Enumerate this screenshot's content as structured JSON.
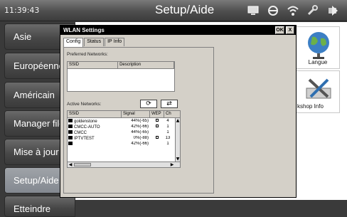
{
  "statusbar": {
    "time": "11:39:43",
    "title": "Setup/Aide"
  },
  "menu": {
    "items": [
      {
        "label": "Asie"
      },
      {
        "label": "Européenne"
      },
      {
        "label": "Américain"
      },
      {
        "label": "Manager file"
      },
      {
        "label": "Mise à jour"
      },
      {
        "label": "Setup/Aide",
        "active": true
      },
      {
        "label": "Etteindre"
      }
    ]
  },
  "tiles": {
    "langue": "Langue",
    "workshop": "kshop Info"
  },
  "dialog": {
    "title": "WLAN Settings",
    "ok_label": "OK",
    "close_label": "X",
    "tabs": [
      "Config",
      "Status",
      "IP Info"
    ],
    "preferred_label": "Preferred Networks:",
    "preferred_columns": [
      "SSID",
      "Description"
    ],
    "active_label": "Active Networks:",
    "active_columns": [
      "SSID",
      "Signal",
      "WEP",
      "Ch"
    ],
    "refresh_glyph": "⟳",
    "connect_glyph": "⇄",
    "networks": [
      {
        "ssid": "goldenstone",
        "signal": "44%(-65)",
        "wep": "lock",
        "ch": "4"
      },
      {
        "ssid": "CMCC-AUTO",
        "signal": "42%(-66)",
        "wep": "lock",
        "ch": "1"
      },
      {
        "ssid": "CMCC",
        "signal": "44%(-65)",
        "wep": "",
        "ch": "1"
      },
      {
        "ssid": "IPTVTEST",
        "signal": "0%(-88)",
        "wep": "lock",
        "ch": "13"
      },
      {
        "ssid": "",
        "signal": "42%(-66)",
        "wep": "",
        "ch": "1"
      }
    ]
  }
}
